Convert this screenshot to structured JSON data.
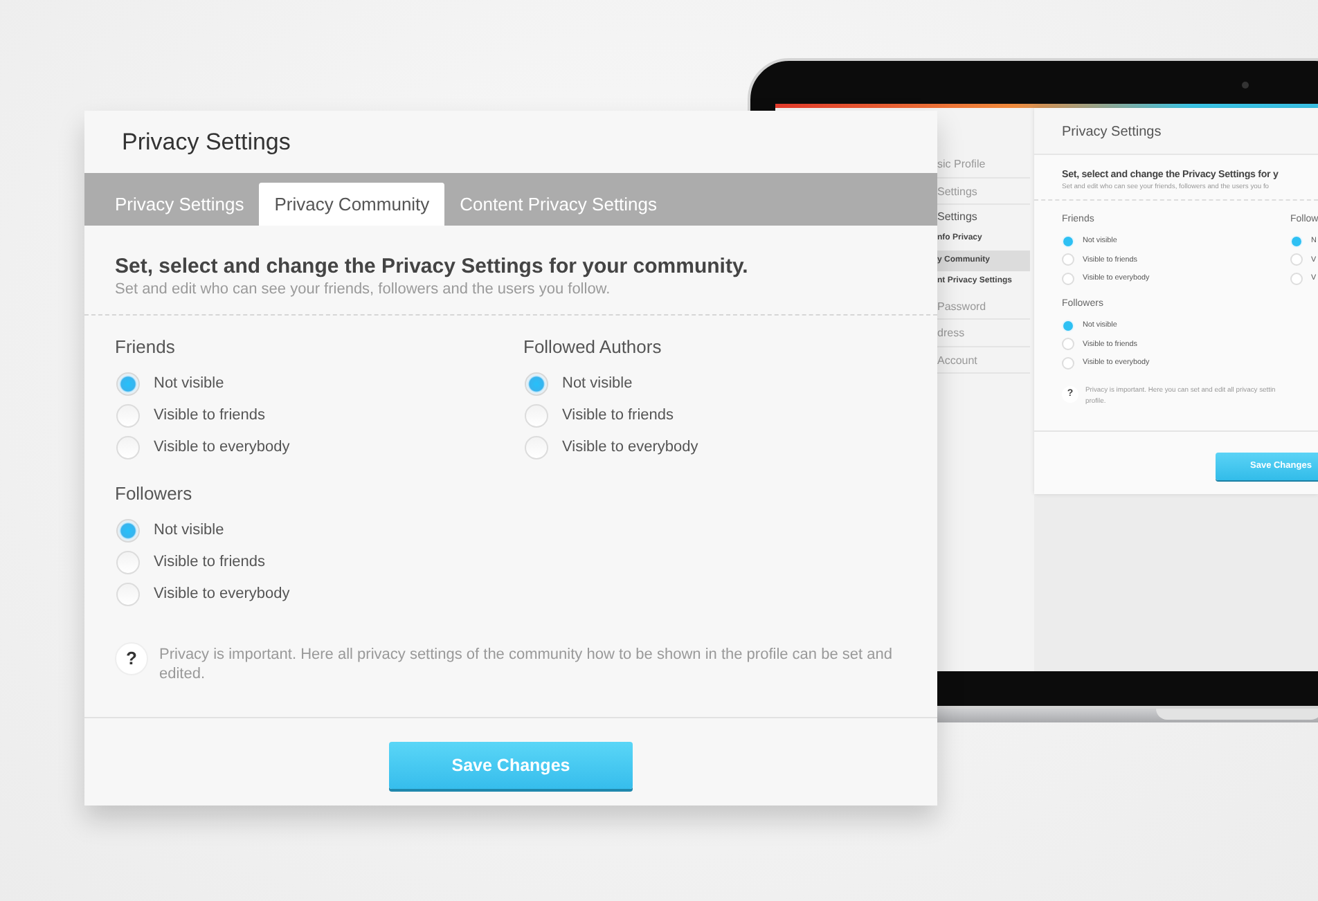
{
  "dialog": {
    "title": "Privacy Settings",
    "tabs": [
      {
        "label": "Privacy Settings",
        "selected": false
      },
      {
        "label": "Privacy Community",
        "selected": true
      },
      {
        "label": "Content Privacy Settings",
        "selected": false
      }
    ],
    "heading": "Set, select and change the Privacy Settings for your community.",
    "subheading": "Set and edit who can see your friends, followers and the users you follow.",
    "groups": [
      {
        "title": "Friends",
        "options": [
          {
            "label": "Not visible",
            "selected": true
          },
          {
            "label": "Visible to friends",
            "selected": false
          },
          {
            "label": "Visible to everybody",
            "selected": false
          }
        ]
      },
      {
        "title": "Followed Authors",
        "options": [
          {
            "label": "Not visible",
            "selected": true
          },
          {
            "label": "Visible to friends",
            "selected": false
          },
          {
            "label": "Visible to everybody",
            "selected": false
          }
        ]
      },
      {
        "title": "Followers",
        "options": [
          {
            "label": "Not visible",
            "selected": true
          },
          {
            "label": "Visible to friends",
            "selected": false
          },
          {
            "label": "Visible to everybody",
            "selected": false
          }
        ]
      }
    ],
    "help": {
      "icon": "?",
      "text": "Privacy is important. Here all privacy settings of the community how to be shown in the profile can be set and edited."
    },
    "save_button": "Save Changes"
  },
  "laptop_screen": {
    "sidebar": [
      {
        "label": "sic Profile",
        "kind": "item",
        "selected": false
      },
      {
        "label": "Settings",
        "kind": "item",
        "selected": false
      },
      {
        "label": "Settings",
        "kind": "section",
        "selected": false
      },
      {
        "label": "nfo Privacy",
        "kind": "sub",
        "selected": false
      },
      {
        "label": "y Community",
        "kind": "sub",
        "selected": true
      },
      {
        "label": "nt Privacy Settings",
        "kind": "sub",
        "selected": false
      },
      {
        "label": "Password",
        "kind": "item",
        "selected": false
      },
      {
        "label": "dress",
        "kind": "item",
        "selected": false
      },
      {
        "label": "Account",
        "kind": "item",
        "selected": false
      }
    ],
    "panel": {
      "title": "Privacy Settings",
      "heading": "Set, select and change the Privacy Settings for y",
      "subheading": "Set and edit who can see your friends, followers and the users you fo",
      "groups": [
        {
          "title": "Friends",
          "options": [
            {
              "label": "Not visible",
              "selected": true
            },
            {
              "label": "Visible to friends",
              "selected": false
            },
            {
              "label": "Visible to everybody",
              "selected": false
            }
          ]
        },
        {
          "title": "Follow",
          "options": [
            {
              "label": "N",
              "selected": true
            },
            {
              "label": "V",
              "selected": false
            },
            {
              "label": "V",
              "selected": false
            }
          ]
        },
        {
          "title": "Followers",
          "options": [
            {
              "label": "Not visible",
              "selected": true
            },
            {
              "label": "Visible to friends",
              "selected": false
            },
            {
              "label": "Visible to everybody",
              "selected": false
            }
          ]
        }
      ],
      "help": {
        "icon": "?",
        "lines": [
          "Privacy is important. Here you can set and edit all privacy settin",
          "profile."
        ]
      },
      "save_button": "Save Changes"
    }
  }
}
